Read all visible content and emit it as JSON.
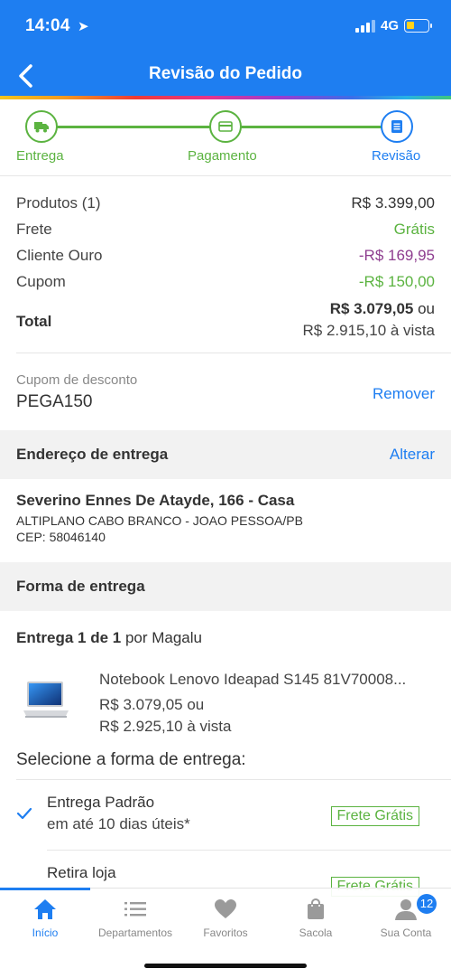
{
  "status_bar": {
    "time": "14:04",
    "network": "4G"
  },
  "header": {
    "title": "Revisão do Pedido"
  },
  "colors": {
    "primary": "#1e7ef1",
    "green": "#5bb340",
    "purple": "#8e3d8f"
  },
  "steps": [
    {
      "label": "Entrega",
      "icon": "truck-icon"
    },
    {
      "label": "Pagamento",
      "icon": "card-icon"
    },
    {
      "label": "Revisão",
      "icon": "list-icon"
    }
  ],
  "summary": {
    "products_label": "Produtos (1)",
    "products_value": "R$ 3.399,00",
    "shipping_label": "Frete",
    "shipping_value": "Grátis",
    "gold_label": "Cliente Ouro",
    "gold_value": "-R$ 169,95",
    "coupon_label": "Cupom",
    "coupon_value": "-R$ 150,00",
    "total_label": "Total",
    "total_value": "R$ 3.079,05",
    "total_or": " ou",
    "total_cash": "R$ 2.915,10 à vista"
  },
  "coupon": {
    "label": "Cupom de desconto",
    "code": "PEGA150",
    "remove": "Remover"
  },
  "address_section": {
    "title": "Endereço de entrega",
    "action": "Alterar",
    "line1": "Severino Ennes De Atayde, 166 - Casa",
    "line2": "ALTIPLANO CABO BRANCO - JOAO PESSOA/PB",
    "line3": "CEP: 58046140"
  },
  "shipping_section": {
    "title": "Forma de entrega",
    "delivery_prefix": "Entrega 1 de 1",
    "delivery_suffix": " por Magalu"
  },
  "product": {
    "name": "Notebook Lenovo Ideapad S145 81V70008...",
    "price": "R$ 3.079,05 ou",
    "cash": "R$ 2.925,10 à vista"
  },
  "choose_label": "Selecione a forma de entrega:",
  "options": [
    {
      "title": "Entrega Padrão",
      "subtitle": "em até 10 dias úteis*",
      "badge": "Frete Grátis"
    },
    {
      "title": "Retira loja",
      "subtitle": "",
      "badge": "Frete Grátis"
    }
  ],
  "tabs": [
    {
      "label": "Início",
      "icon": "home-icon"
    },
    {
      "label": "Departamentos",
      "icon": "menu-icon"
    },
    {
      "label": "Favoritos",
      "icon": "heart-icon"
    },
    {
      "label": "Sacola",
      "icon": "bag-icon"
    },
    {
      "label": "Sua Conta",
      "icon": "user-icon",
      "badge": "12"
    }
  ]
}
